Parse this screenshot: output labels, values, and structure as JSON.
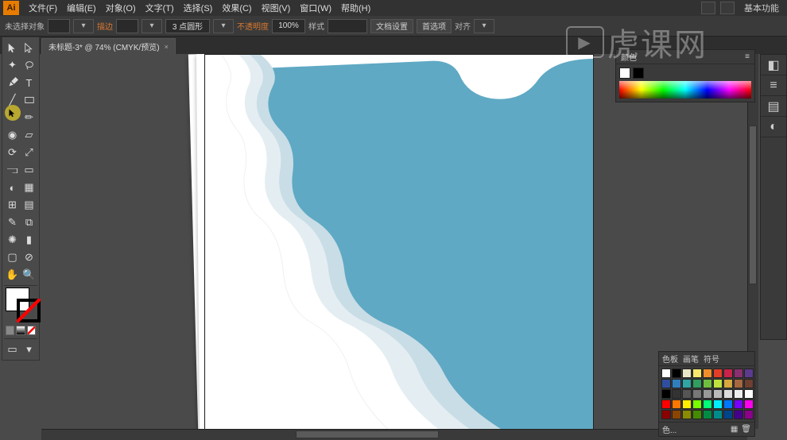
{
  "app": {
    "logo": "Ai",
    "workspace": "基本功能"
  },
  "menu": {
    "file": "文件(F)",
    "edit": "编辑(E)",
    "object": "对象(O)",
    "type": "文字(T)",
    "select": "选择(S)",
    "effect": "效果(C)",
    "view": "视图(V)",
    "window": "窗口(W)",
    "help": "帮助(H)"
  },
  "control": {
    "no_selection": "未选择对象",
    "stroke_label": "描边",
    "stroke_weight": "3 点圆形",
    "opacity_label": "不透明度",
    "opacity_value": "100%",
    "style_label": "样式",
    "doc_setup": "文档设置",
    "preferences": "首选项",
    "align_label": "对齐"
  },
  "document": {
    "tab_title": "未标题-3* @ 74% (CMYK/预览)",
    "close": "×"
  },
  "panels": {
    "color_title": "颜色",
    "swatches_title": "色板",
    "swatches_tab2": "画笔",
    "swatches_tab3": "符号",
    "swatches_footer": "色..."
  },
  "watermark": {
    "text": "虎课网",
    "icon": "▶"
  },
  "swatch_colors": [
    "#ffffff",
    "#000000",
    "#e8e8c8",
    "#f7e96b",
    "#f08e2b",
    "#e23d28",
    "#c9234a",
    "#8a2f6f",
    "#5c3a8e",
    "#2f4f9e",
    "#2f7fbf",
    "#2fa5a5",
    "#2f9e5f",
    "#6fbf3f",
    "#bfe23f",
    "#d8a83f",
    "#a8683f",
    "#6f3f2f",
    "#000000",
    "#333333",
    "#555555",
    "#777777",
    "#999999",
    "#bbbbbb",
    "#dddddd",
    "#eeeeee",
    "#ffffff",
    "#ff0000",
    "#ff7700",
    "#ffee00",
    "#77ff00",
    "#00ff77",
    "#00eeff",
    "#0077ff",
    "#7700ff",
    "#ff00ee",
    "#8b0000",
    "#8b4500",
    "#8b8b00",
    "#458b00",
    "#008b45",
    "#008b8b",
    "#00458b",
    "#45008b",
    "#8b008b"
  ]
}
